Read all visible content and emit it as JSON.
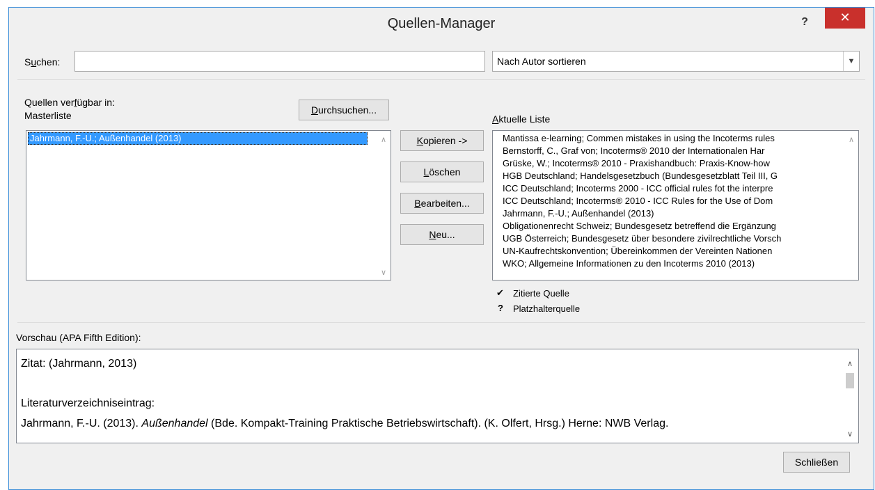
{
  "window": {
    "title": "Quellen-Manager",
    "help_label": "?",
    "close_label": "✕"
  },
  "search": {
    "label_pre": "S",
    "label_ul": "u",
    "label_post": "chen:",
    "value": ""
  },
  "sort": {
    "selected": "Nach Autor sortieren"
  },
  "available": {
    "label_pre": "Quellen ver",
    "label_ul": "f",
    "label_post": "ügbar in:",
    "list_name": "Masterliste"
  },
  "browse_button": {
    "pre": "",
    "ul": "D",
    "post": "urchsuchen..."
  },
  "master_list": [
    "Jahrmann, F.-U.; Außenhandel (2013)"
  ],
  "buttons": {
    "copy": {
      "pre": "",
      "ul": "K",
      "post": "opieren ->"
    },
    "delete": {
      "pre": "",
      "ul": "L",
      "post": "öschen"
    },
    "edit": {
      "pre": "",
      "ul": "B",
      "post": "earbeiten..."
    },
    "new": {
      "pre": "",
      "ul": "N",
      "post": "eu..."
    },
    "close": {
      "pre": "Schließen",
      "ul": "",
      "post": ""
    }
  },
  "current": {
    "label_pre": "",
    "label_ul": "A",
    "label_post": "ktuelle Liste"
  },
  "current_list": [
    "Mantissa e-learning; Commen mistakes in using the Incoterms rules",
    "Bernstorff, C., Graf von; Incoterms® 2010 der Internationalen Har",
    "Grüske, W.; Incoterms® 2010 - Praxishandbuch: Praxis-Know-how",
    "HGB Deutschland; Handelsgesetzbuch (Bundesgesetzblatt Teil III, G",
    "ICC Deutschland; Incoterms 2000 - ICC official rules fot the interpre",
    "ICC Deutschland; Incoterms® 2010 - ICC Rules for the Use of Dom",
    "Jahrmann, F.-U.; Außenhandel (2013)",
    "Obligationenrecht Schweiz; Bundesgesetz betreffend die Ergänzung",
    "UGB Österreich; Bundesgesetz über besondere zivilrechtliche Vorsch",
    "UN-Kaufrechtskonvention; Übereinkommen der Vereinten Nationen",
    "WKO; Allgemeine Informationen zu den Incoterms 2010 (2013)"
  ],
  "legend": {
    "cited_symbol": "✔",
    "cited_label": "Zitierte Quelle",
    "placeholder_symbol": "?",
    "placeholder_label": "Platzhalterquelle"
  },
  "preview": {
    "label": "Vorschau (APA Fifth Edition):",
    "citation": "Zitat:  (Jahrmann, 2013)",
    "bib_heading": "Literaturverzeichniseintrag:",
    "bib_pre": "Jahrmann, F.-U. (2013). ",
    "bib_italic": "Außenhandel",
    "bib_post": " (Bde. Kompakt-Training Praktische Betriebswirtschaft). (K. Olfert, Hrsg.) Herne: NWB Verlag."
  }
}
